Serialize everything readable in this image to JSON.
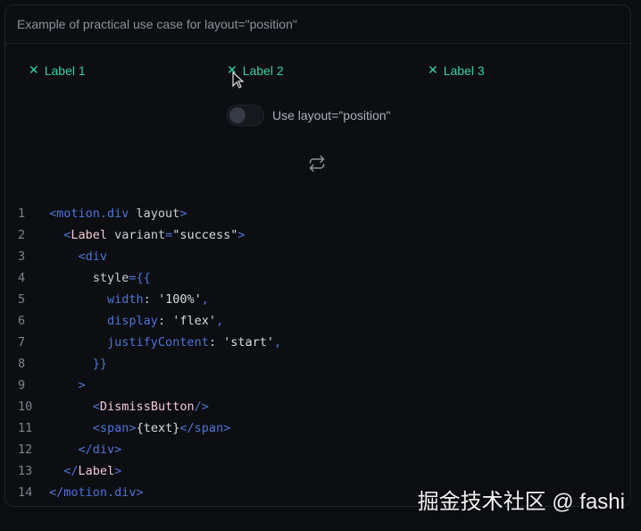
{
  "header": {
    "title": "Example of practical use case for layout=\"position\""
  },
  "labels": [
    {
      "text": "Label 1"
    },
    {
      "text": "Label 2"
    },
    {
      "text": "Label 3"
    }
  ],
  "dismiss_glyph": "✕",
  "toggle": {
    "label": "Use layout=\"position\"",
    "checked": false
  },
  "replay_icon": "repeat-icon",
  "code": {
    "lines": [
      [
        [
          "t-tag",
          "<motion.div"
        ],
        [
          "t-attr",
          " layout"
        ],
        [
          "t-tag",
          ">"
        ]
      ],
      [
        [
          "t-punc",
          "  "
        ],
        [
          "t-tag",
          "<"
        ],
        [
          "t-comp",
          "Label"
        ],
        [
          "t-attr",
          " variant"
        ],
        [
          "t-tag",
          "="
        ],
        [
          "t-str",
          "\"success\""
        ],
        [
          "t-tag",
          ">"
        ]
      ],
      [
        [
          "t-punc",
          "    "
        ],
        [
          "t-tag",
          "<div"
        ]
      ],
      [
        [
          "t-punc",
          "      "
        ],
        [
          "t-attr",
          "style"
        ],
        [
          "t-tag",
          "={{"
        ]
      ],
      [
        [
          "t-punc",
          "        "
        ],
        [
          "t-prop",
          "width"
        ],
        [
          "t-punc",
          ": "
        ],
        [
          "t-str",
          "'100%'"
        ],
        [
          "t-tag",
          ","
        ]
      ],
      [
        [
          "t-punc",
          "        "
        ],
        [
          "t-prop",
          "display"
        ],
        [
          "t-punc",
          ": "
        ],
        [
          "t-str",
          "'flex'"
        ],
        [
          "t-tag",
          ","
        ]
      ],
      [
        [
          "t-punc",
          "        "
        ],
        [
          "t-prop",
          "justifyContent"
        ],
        [
          "t-punc",
          ": "
        ],
        [
          "t-str",
          "'start'"
        ],
        [
          "t-tag",
          ","
        ]
      ],
      [
        [
          "t-punc",
          "      "
        ],
        [
          "t-tag",
          "}}"
        ]
      ],
      [
        [
          "t-punc",
          "    "
        ],
        [
          "t-tag",
          ">"
        ]
      ],
      [
        [
          "t-punc",
          "      "
        ],
        [
          "t-tag",
          "<"
        ],
        [
          "t-comp",
          "DismissButton"
        ],
        [
          "t-tag",
          "/>"
        ]
      ],
      [
        [
          "t-punc",
          "      "
        ],
        [
          "t-tag",
          "<span>"
        ],
        [
          "t-str",
          "{text}"
        ],
        [
          "t-tag",
          "</span>"
        ]
      ],
      [
        [
          "t-punc",
          "    "
        ],
        [
          "t-tag",
          "</div>"
        ]
      ],
      [
        [
          "t-punc",
          "  "
        ],
        [
          "t-tag",
          "</"
        ],
        [
          "t-comp",
          "Label"
        ],
        [
          "t-tag",
          ">"
        ]
      ],
      [
        [
          "t-tag",
          "</motion.div>"
        ]
      ]
    ]
  },
  "watermark": "掘金技术社区 @ fashi"
}
